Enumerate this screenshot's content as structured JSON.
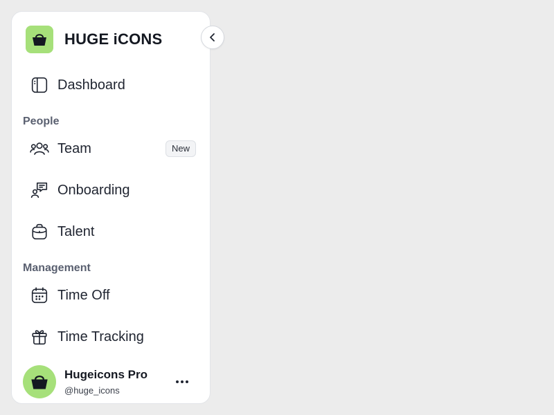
{
  "brand": {
    "title": "HUGE iCONS",
    "accent": "#a6e07a"
  },
  "nav": {
    "dashboard": {
      "label": "Dashboard",
      "icon": "sidebar-layout-icon"
    },
    "people_section": "People",
    "team": {
      "label": "Team",
      "icon": "user-group-icon",
      "badge": "New"
    },
    "onboarding": {
      "label": "Onboarding",
      "icon": "user-message-icon"
    },
    "talent": {
      "label": "Talent",
      "icon": "briefcase-icon"
    },
    "management_section": "Management",
    "time_off": {
      "label": "Time Off",
      "icon": "calendar-icon"
    },
    "time_tracking": {
      "label": "Time Tracking",
      "icon": "gift-icon"
    }
  },
  "profile": {
    "name": "Hugeicons Pro",
    "handle": "@huge_icons"
  }
}
